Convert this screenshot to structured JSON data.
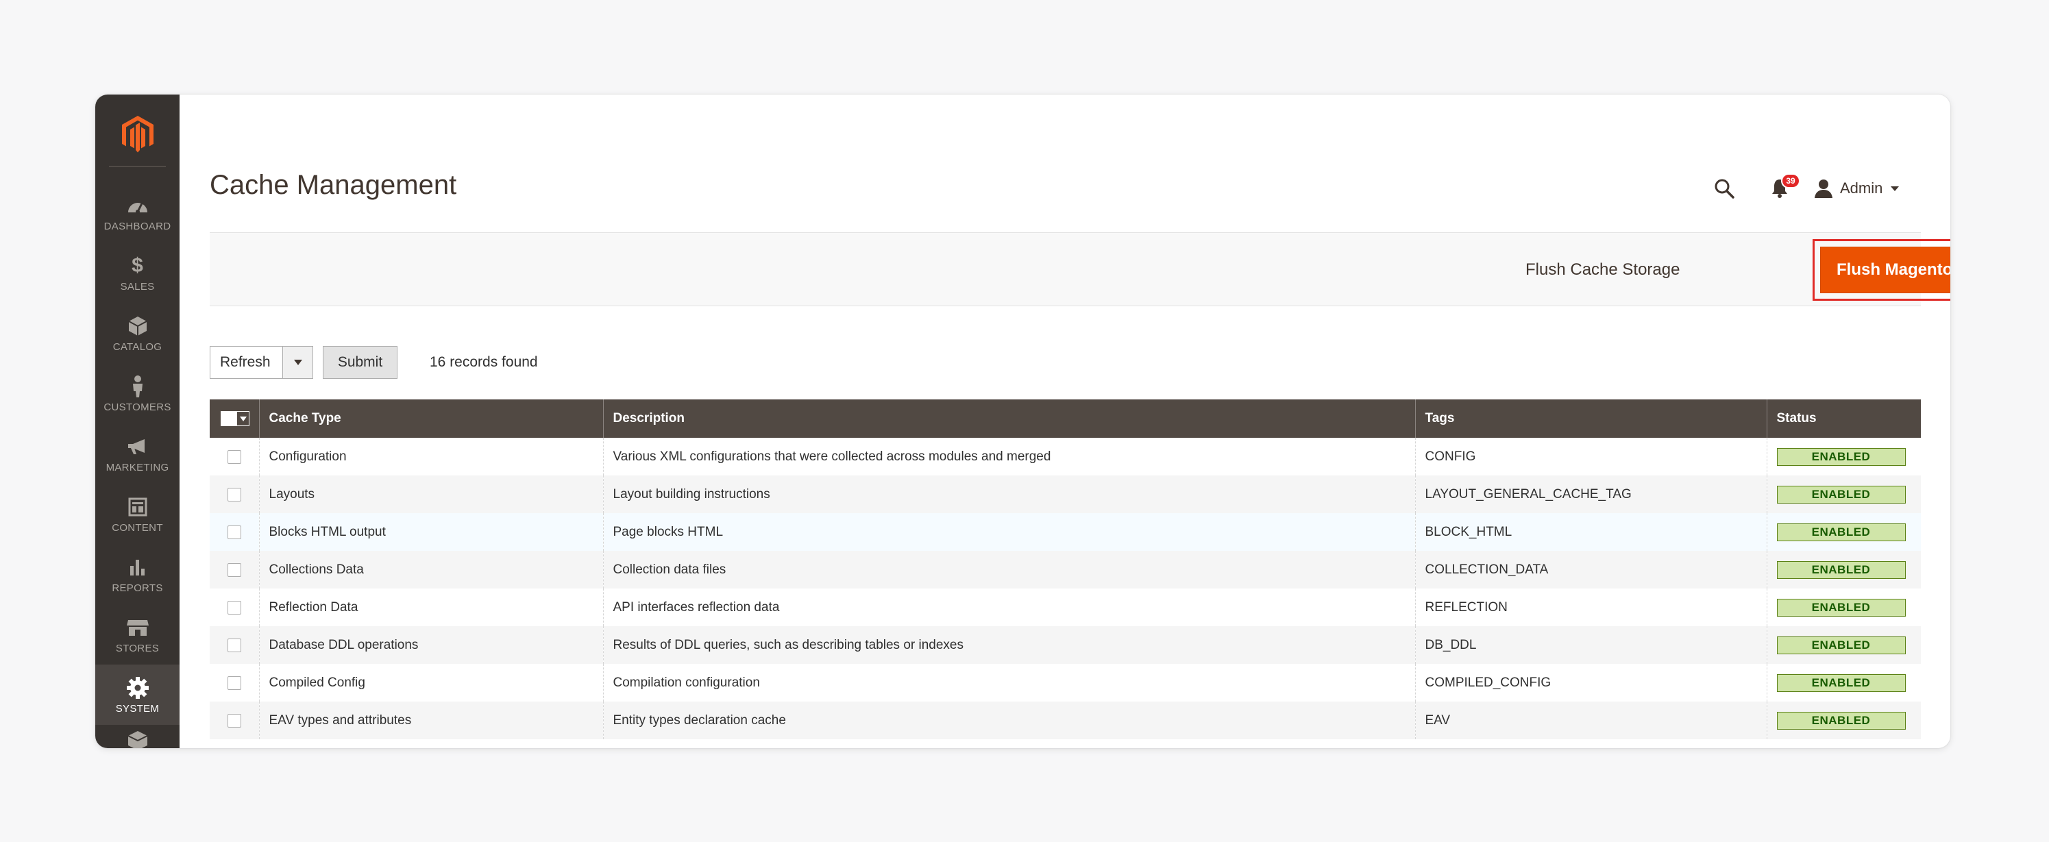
{
  "sidebar": {
    "logo_name": "magento-logo",
    "items": [
      {
        "label": "DASHBOARD",
        "icon": "dashboard-icon"
      },
      {
        "label": "SALES",
        "icon": "dollar-icon"
      },
      {
        "label": "CATALOG",
        "icon": "cube-icon"
      },
      {
        "label": "CUSTOMERS",
        "icon": "person-icon"
      },
      {
        "label": "MARKETING",
        "icon": "megaphone-icon"
      },
      {
        "label": "CONTENT",
        "icon": "layout-icon"
      },
      {
        "label": "REPORTS",
        "icon": "bar-chart-icon"
      },
      {
        "label": "STORES",
        "icon": "storefront-icon"
      },
      {
        "label": "SYSTEM",
        "icon": "gear-icon",
        "active": true
      }
    ]
  },
  "header": {
    "title": "Cache Management",
    "notifications_count": "39",
    "user_label": "Admin"
  },
  "actions": {
    "flush_cache_storage": "Flush Cache Storage",
    "flush_magento_cache": "Flush Magento Cache"
  },
  "mass_action": {
    "selected": "Refresh",
    "submit": "Submit",
    "records_found": "16 records found"
  },
  "grid": {
    "columns": [
      "Cache Type",
      "Description",
      "Tags",
      "Status"
    ],
    "rows": [
      {
        "type": "Configuration",
        "description": "Various XML configurations that were collected across modules and merged",
        "tags": "CONFIG",
        "status": "ENABLED"
      },
      {
        "type": "Layouts",
        "description": "Layout building instructions",
        "tags": "LAYOUT_GENERAL_CACHE_TAG",
        "status": "ENABLED"
      },
      {
        "type": "Blocks HTML output",
        "description": "Page blocks HTML",
        "tags": "BLOCK_HTML",
        "status": "ENABLED"
      },
      {
        "type": "Collections Data",
        "description": "Collection data files",
        "tags": "COLLECTION_DATA",
        "status": "ENABLED"
      },
      {
        "type": "Reflection Data",
        "description": "API interfaces reflection data",
        "tags": "REFLECTION",
        "status": "ENABLED"
      },
      {
        "type": "Database DDL operations",
        "description": "Results of DDL queries, such as describing tables or indexes",
        "tags": "DB_DDL",
        "status": "ENABLED"
      },
      {
        "type": "Compiled Config",
        "description": "Compilation configuration",
        "tags": "COMPILED_CONFIG",
        "status": "ENABLED"
      },
      {
        "type": "EAV types and attributes",
        "description": "Entity types declaration cache",
        "tags": "EAV",
        "status": "ENABLED"
      }
    ]
  },
  "colors": {
    "accent": "#eb5202",
    "sidebar": "#373330",
    "grid_header": "#514943",
    "status_enabled_bg": "#d0e5a9",
    "status_enabled_text": "#185b00",
    "highlight": "#e02b27"
  }
}
